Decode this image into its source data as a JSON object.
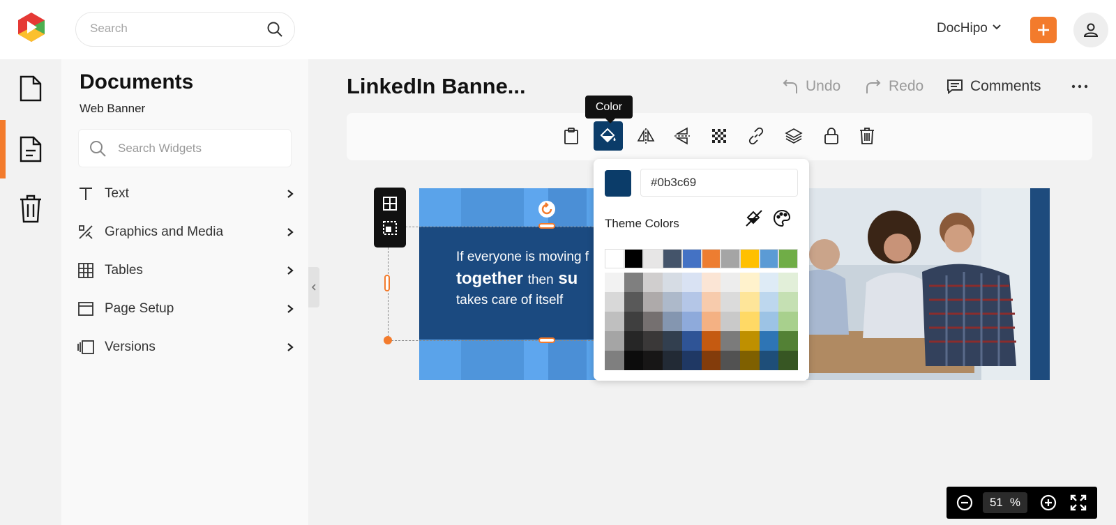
{
  "header": {
    "search_placeholder": "Search",
    "brand": "DocHipo"
  },
  "panel": {
    "title": "Documents",
    "subtitle": "Web Banner",
    "search_placeholder": "Search Widgets",
    "items": [
      {
        "label": "Text",
        "icon": "text-icon"
      },
      {
        "label": "Graphics and Media",
        "icon": "graphics-icon"
      },
      {
        "label": "Tables",
        "icon": "table-icon"
      },
      {
        "label": "Page Setup",
        "icon": "page-setup-icon"
      },
      {
        "label": "Versions",
        "icon": "versions-icon"
      }
    ]
  },
  "document": {
    "title": "LinkedIn Banne...",
    "undo": "Undo",
    "redo": "Redo",
    "comments": "Comments"
  },
  "toolbar": {
    "tooltip": "Color",
    "active_tool": "color"
  },
  "banner": {
    "line1": "If everyone is moving f",
    "line2_bold": "together",
    "line2_small": "then",
    "line2_bold2": "su",
    "line3": "takes care of itself"
  },
  "color_picker": {
    "current_hex": "#0b3c69",
    "theme_label": "Theme Colors",
    "theme_row": [
      "#ffffff",
      "#000000",
      "#e7e6e6",
      "#44546a",
      "#4472c4",
      "#ed7d31",
      "#a5a5a5",
      "#ffc000",
      "#5b9bd5",
      "#70ad47"
    ],
    "shades": [
      [
        "#f2f2f2",
        "#7f7f7f",
        "#d0cece",
        "#d6dce4",
        "#d9e2f3",
        "#fbe5d5",
        "#ededed",
        "#fff2cc",
        "#deebf6",
        "#e2efd9"
      ],
      [
        "#d8d8d8",
        "#595959",
        "#aeaaaa",
        "#adb9ca",
        "#b4c6e7",
        "#f7cbac",
        "#dbdbdb",
        "#fee599",
        "#bdd7ee",
        "#c5e0b3"
      ],
      [
        "#bfbfbf",
        "#3f3f3f",
        "#757070",
        "#8496b0",
        "#8eaadb",
        "#f4b183",
        "#c9c9c9",
        "#ffd965",
        "#9cc3e5",
        "#a8d08d"
      ],
      [
        "#a5a5a5",
        "#262626",
        "#3a3838",
        "#323f4f",
        "#2f5496",
        "#c55a11",
        "#7b7b7b",
        "#bf9000",
        "#2e75b5",
        "#538135"
      ],
      [
        "#7f7f7f",
        "#0c0c0c",
        "#171616",
        "#222a35",
        "#1f3864",
        "#833c0b",
        "#525252",
        "#7f6000",
        "#1e4e79",
        "#375623"
      ]
    ]
  },
  "zoom": {
    "value": "51",
    "unit": "%"
  },
  "colors": {
    "accent": "#f37b2c",
    "selected_fill": "#0b3c69"
  }
}
